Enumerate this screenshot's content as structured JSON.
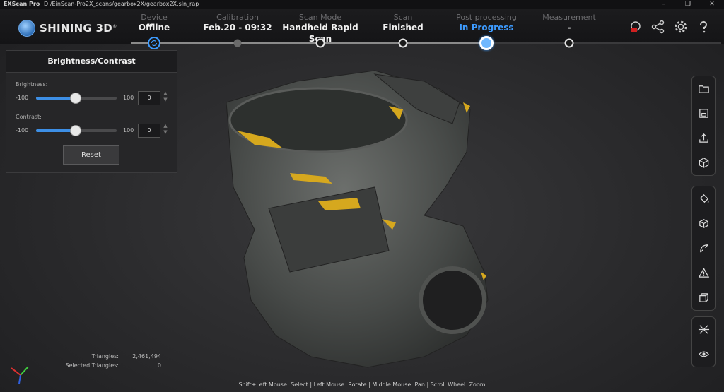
{
  "window": {
    "app_name": "EXScan Pro",
    "file_path": "D:/EinScan-Pro2X_scans/gearbox2X/gearbox2X.sln_rap",
    "controls": [
      "–",
      "❐",
      "✕"
    ]
  },
  "brand": {
    "name": "SHINING 3D",
    "mark": "®"
  },
  "steps": [
    {
      "label": "Device",
      "value": "Offline"
    },
    {
      "label": "Calibration",
      "value": "Feb.20 - 09:32"
    },
    {
      "label": "Scan Mode",
      "value": "Handheld Rapid Scan"
    },
    {
      "label": "Scan",
      "value": "Finished"
    },
    {
      "label": "Post processing",
      "value": "In Progress"
    },
    {
      "label": "Measurement",
      "value": "-"
    }
  ],
  "header_icons": [
    "record-icon",
    "share-icon",
    "settings-icon",
    "help-icon"
  ],
  "brightness_panel": {
    "title": "Brightness/Contrast",
    "brightness": {
      "label": "Brightness:",
      "min": "-100",
      "max": "100",
      "value": "0"
    },
    "contrast": {
      "label": "Contrast:",
      "min": "-100",
      "max": "100",
      "value": "0"
    },
    "reset_label": "Reset"
  },
  "right_toolbar": [
    [
      "open-folder-icon",
      "save-icon",
      "export-icon",
      "3d-box-icon"
    ],
    [
      "paint-bucket-icon",
      "cube-icon",
      "curve-icon",
      "triangle-warning-icon",
      "wireframe-cube-icon"
    ],
    [
      "align-icon",
      "eye-icon"
    ]
  ],
  "stats": {
    "triangles_label": "Triangles:",
    "triangles_value": "2,461,494",
    "selected_label": "Selected Triangles:",
    "selected_value": "0"
  },
  "hint": "Shift+Left Mouse: Select | Left Mouse: Rotate | Middle Mouse: Pan | Scroll Wheel: Zoom",
  "colors": {
    "accent": "#3d9bff",
    "highlight": "#e0b020"
  }
}
